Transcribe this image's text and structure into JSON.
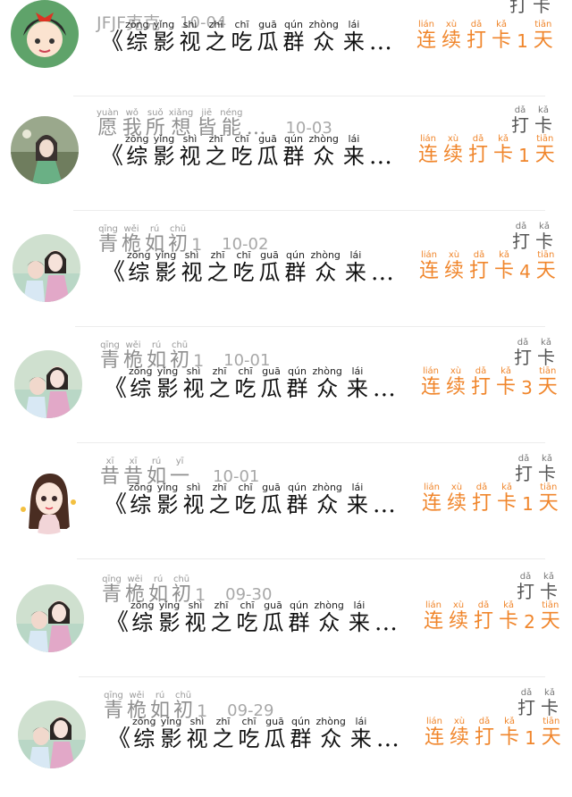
{
  "feed": {
    "title_prefix": "《",
    "title_chars": [
      {
        "py": "zōng",
        "ch": "综"
      },
      {
        "py": "yǐng",
        "ch": "影"
      },
      {
        "py": "shì",
        "ch": "视"
      },
      {
        "py": "zhī",
        "ch": "之"
      },
      {
        "py": "chī",
        "ch": "吃"
      },
      {
        "py": "guā",
        "ch": "瓜"
      },
      {
        "py": "qún",
        "ch": "群"
      },
      {
        "py": "zhòng",
        "ch": "众"
      },
      {
        "py": "lái",
        "ch": "来"
      }
    ],
    "title_suffix": "…",
    "streak_prefix": [
      {
        "py": "lián",
        "ch": "连"
      },
      {
        "py": "xù",
        "ch": "续"
      },
      {
        "py": "dǎ",
        "ch": "打"
      },
      {
        "py": "kǎ",
        "ch": "卡"
      }
    ],
    "streak_suffix": {
      "py": "tiān",
      "ch": "天"
    },
    "checkin": [
      {
        "py": "dǎ",
        "ch": "打"
      },
      {
        "py": "kǎ",
        "ch": "卡"
      }
    ],
    "accent_color": "#f0862c",
    "items": [
      {
        "user_plain": "JFJF克克",
        "user_chars": [],
        "date": "10-04",
        "streak": "1",
        "avatar": "girl-cartoon-avatar"
      },
      {
        "user_plain": "",
        "user_chars": [
          {
            "py": "yuàn",
            "ch": "愿"
          },
          {
            "py": "wǒ",
            "ch": "我"
          },
          {
            "py": "suǒ",
            "ch": "所"
          },
          {
            "py": "xiǎng",
            "ch": "想"
          },
          {
            "py": "jiē",
            "ch": "皆"
          },
          {
            "py": "néng",
            "ch": "能"
          }
        ],
        "user_suffix": "…",
        "date": "10-03",
        "streak": "1",
        "avatar": "woman-photo-avatar"
      },
      {
        "user_plain": "",
        "user_chars": [
          {
            "py": "qīng",
            "ch": "青"
          },
          {
            "py": "wěi",
            "ch": "桅"
          },
          {
            "py": "rú",
            "ch": "如"
          },
          {
            "py": "chū",
            "ch": "初"
          }
        ],
        "user_num": "1",
        "date": "10-02",
        "streak": "4",
        "avatar": "mother-child-avatar"
      },
      {
        "user_plain": "",
        "user_chars": [
          {
            "py": "qīng",
            "ch": "青"
          },
          {
            "py": "wěi",
            "ch": "桅"
          },
          {
            "py": "rú",
            "ch": "如"
          },
          {
            "py": "chū",
            "ch": "初"
          }
        ],
        "user_num": "1",
        "date": "10-01",
        "streak": "3",
        "avatar": "mother-child-avatar"
      },
      {
        "user_plain": "",
        "user_chars": [
          {
            "py": "xī",
            "ch": "昔"
          },
          {
            "py": "xī",
            "ch": "昔"
          },
          {
            "py": "rú",
            "ch": "如"
          },
          {
            "py": "yī",
            "ch": "一"
          }
        ],
        "date": "10-01",
        "streak": "1",
        "avatar": "anime-girl-avatar"
      },
      {
        "user_plain": "",
        "user_chars": [
          {
            "py": "qīng",
            "ch": "青"
          },
          {
            "py": "wěi",
            "ch": "桅"
          },
          {
            "py": "rú",
            "ch": "如"
          },
          {
            "py": "chū",
            "ch": "初"
          }
        ],
        "user_num": "1",
        "date": "09-30",
        "streak": "2",
        "avatar": "mother-child-avatar"
      },
      {
        "user_plain": "",
        "user_chars": [
          {
            "py": "qīng",
            "ch": "青"
          },
          {
            "py": "wěi",
            "ch": "桅"
          },
          {
            "py": "rú",
            "ch": "如"
          },
          {
            "py": "chū",
            "ch": "初"
          }
        ],
        "user_num": "1",
        "date": "09-29",
        "streak": "1",
        "avatar": "mother-child-avatar"
      }
    ]
  }
}
